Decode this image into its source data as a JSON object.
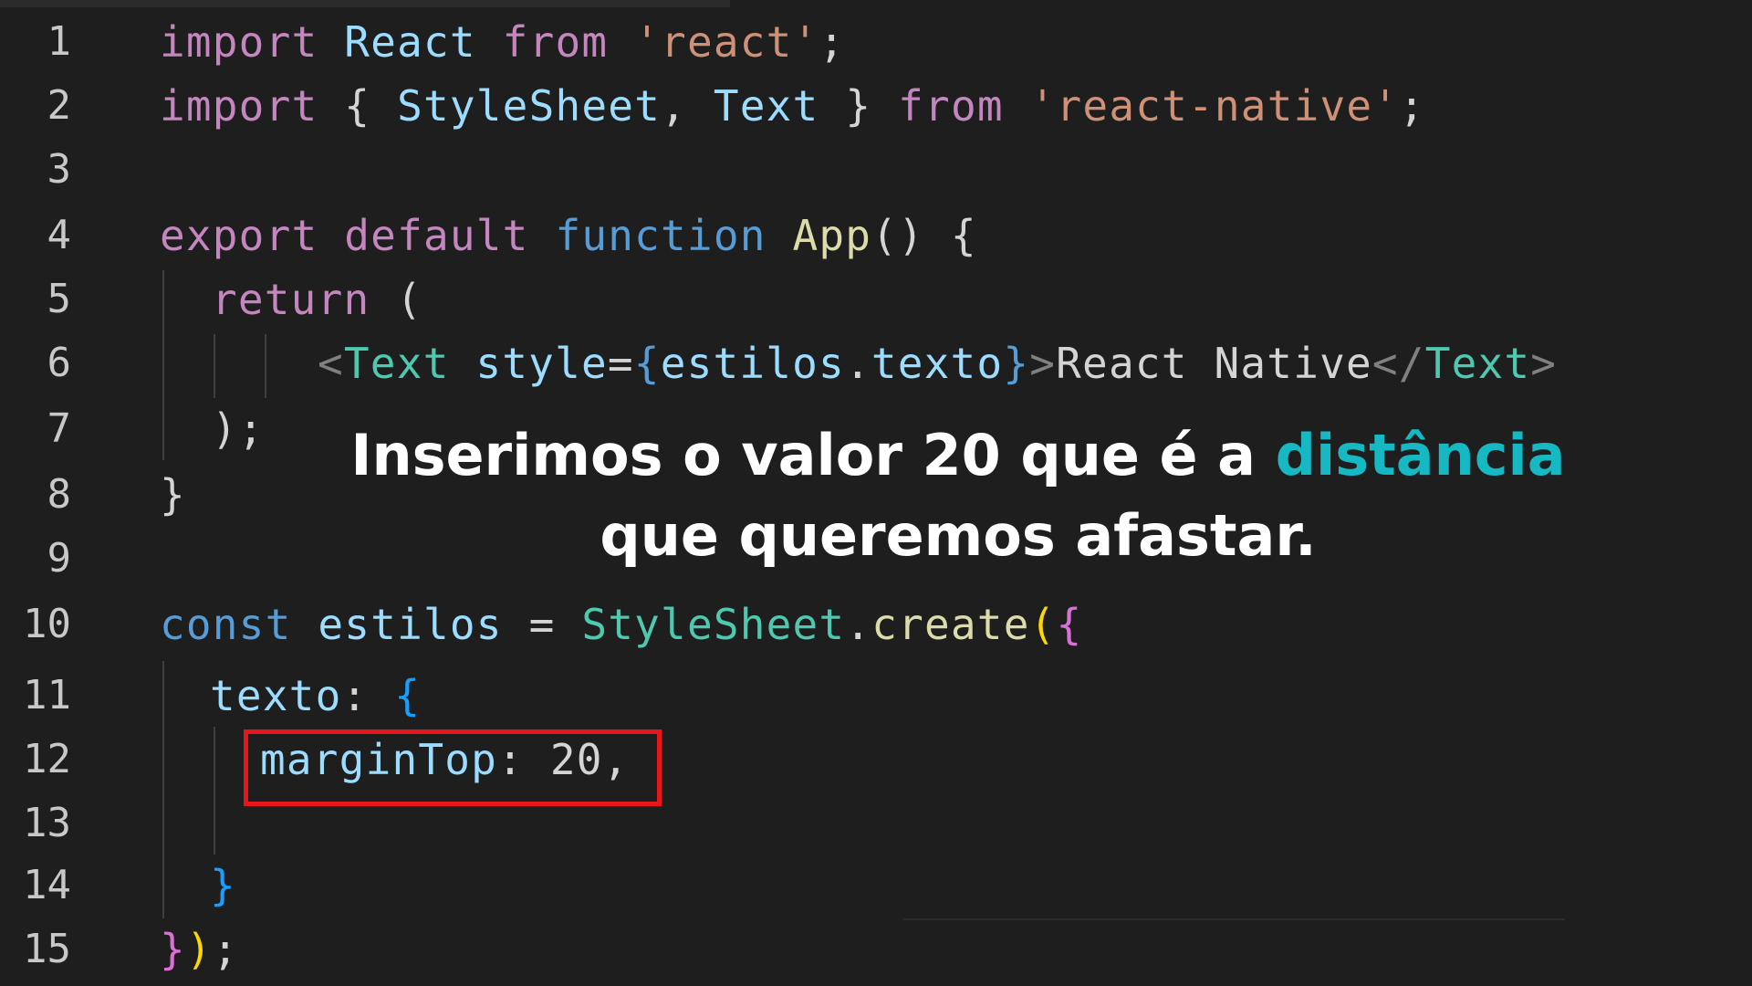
{
  "editor": {
    "line_numbers": [
      "1",
      "2",
      "3",
      "4",
      "5",
      "6",
      "7",
      "8",
      "9",
      "10",
      "11",
      "12",
      "13",
      "14",
      "15"
    ],
    "line1": {
      "import": "import",
      "name": "React",
      "from": "from",
      "module": "'react'",
      "semi": ";"
    },
    "line2": {
      "import": "import",
      "open_brace": "{",
      "name1": "StyleSheet",
      "comma": ",",
      "name2": "Text",
      "close_brace": "}",
      "from": "from",
      "module": "'react-native'",
      "semi": ";"
    },
    "line4": {
      "export": "export",
      "default": "default",
      "function": "function",
      "name": "App",
      "parens": "()",
      "open_brace": "{"
    },
    "line5": {
      "return": "return",
      "paren": "("
    },
    "line6": {
      "lt": "<",
      "tag": "Text",
      "attr": "style",
      "eq": "=",
      "ob": "{",
      "obj": "estilos",
      "dot": ".",
      "prop": "texto",
      "cb": "}",
      "gt": ">",
      "content": "React Native",
      "close_lt": "</",
      "close_tag": "Text",
      "close_gt": ">"
    },
    "line7": {
      "text": ");"
    },
    "line8": {
      "text": "}"
    },
    "line10": {
      "const": "const",
      "name": "estilos",
      "eq": "=",
      "cls": "StyleSheet",
      "dot": ".",
      "method": "create",
      "paren": "(",
      "brace": "{"
    },
    "line11": {
      "key": "texto",
      "colon": ":",
      "brace": "{"
    },
    "line12": {
      "key": "marginTop",
      "colon": ":",
      "value": "20",
      "comma": ","
    },
    "line14": {
      "text": "}"
    },
    "line15": {
      "brace": "}",
      "paren": ")",
      "semi": ";"
    }
  },
  "caption": {
    "line1_prefix": "Inserimos o valor 20 que é a ",
    "line1_accent": "distância",
    "line2": "que queremos afastar."
  },
  "colors": {
    "background": "#1e1e1e",
    "highlight_border": "#e8161b",
    "caption_accent": "#16b8c3"
  }
}
